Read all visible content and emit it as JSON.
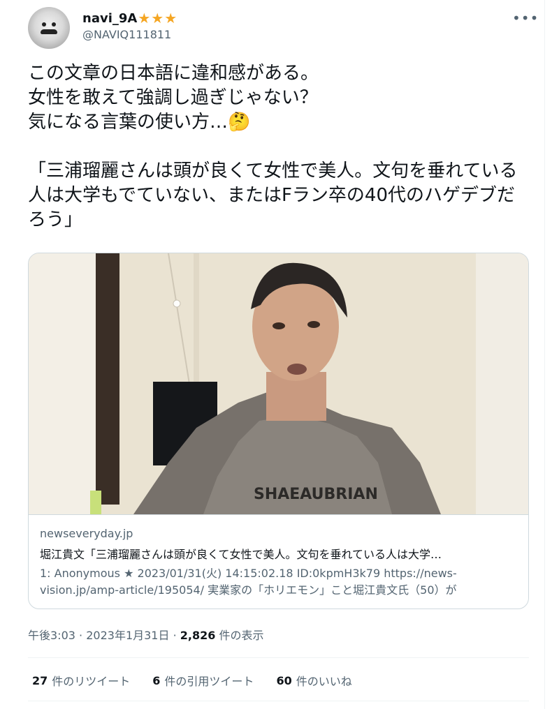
{
  "user": {
    "display_name": "navi_9A",
    "stars": "★★★",
    "handle": "@NAVIQ111811"
  },
  "tweet": {
    "text": "この文章の日本語に違和感がある。\n女性を敢えて強調し過ぎじゃない？\n気になる言葉の使い方…🤔\n\n「三浦瑠麗さんは頭が良くて女性で美人。文句を垂れている人は大学もでていない、またはFラン卒の40代のハゲデブだろう」"
  },
  "card": {
    "domain": "newseveryday.jp",
    "title": "堀江貴文「三浦瑠麗さんは頭が良くて女性で美人。文句を垂れている人は大学…",
    "description": "1: Anonymous ★ 2023/01/31(火) 14:15:02.18 ID:0kpmH3k79 https://news-vision.jp/amp-article/195054/ 実業家の「ホリエモン」こと堀江貴文氏（50）が",
    "image_caption": "SHAEAUBRIAN"
  },
  "meta": {
    "time": "午後3:03",
    "dot1": "·",
    "date": "2023年1月31日",
    "dot2": "·",
    "views_count": "2,826",
    "views_label": "件の表示"
  },
  "stats": {
    "retweets_count": "27",
    "retweets_label": "件のリツイート",
    "quotes_count": "6",
    "quotes_label": "件の引用ツイート",
    "likes_count": "60",
    "likes_label": "件のいいね"
  },
  "icons": {
    "more": "more-icon",
    "avatar": "avatar"
  },
  "colors": {
    "text": "#0f1419",
    "secondary": "#536471",
    "border": "#cfd9de",
    "star": "#f5a623"
  }
}
